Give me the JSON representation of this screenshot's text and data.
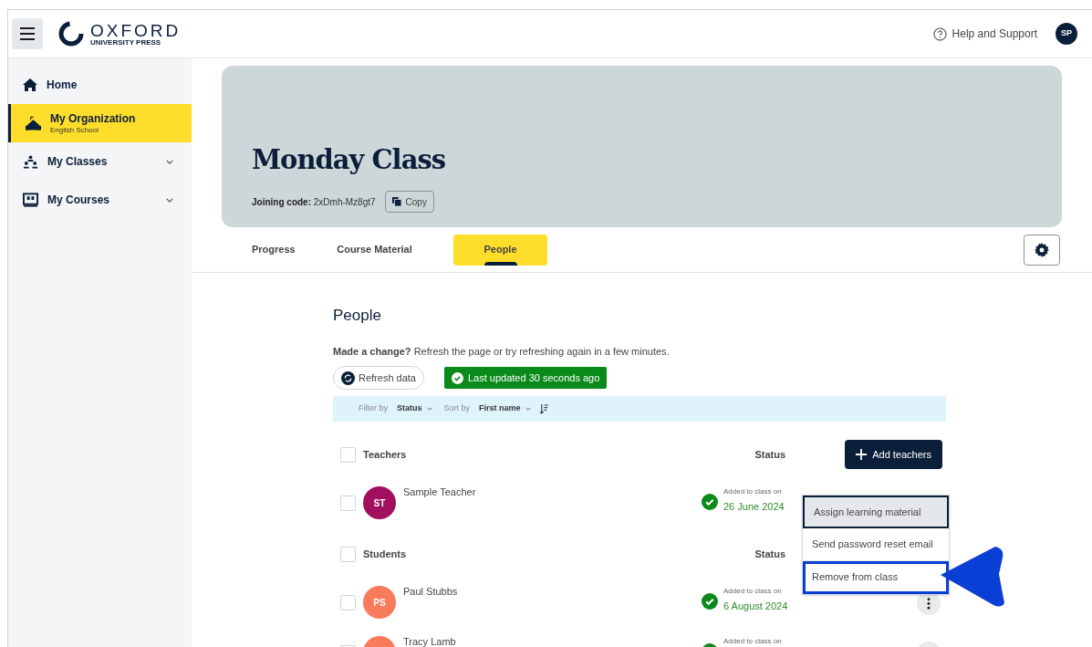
{
  "header": {
    "logo": {
      "name": "OXFORD",
      "sub": "UNIVERSITY PRESS"
    },
    "help": "Help and Support",
    "avatar": "SP"
  },
  "sidebar": {
    "items": [
      {
        "kind": "home",
        "label": "Home",
        "selected": false,
        "expandable": false
      },
      {
        "kind": "organization",
        "label": "My Organization",
        "sublabel": "English School",
        "selected": true,
        "expandable": false
      },
      {
        "kind": "classes",
        "label": "My Classes",
        "selected": false,
        "expandable": true
      },
      {
        "kind": "courses",
        "label": "My Courses",
        "selected": false,
        "expandable": true
      }
    ]
  },
  "banner": {
    "title": "Monday Class",
    "joining_label": "Joining code:",
    "code": "2xDmh-Mz8gt7",
    "copy": "Copy"
  },
  "tabs": [
    {
      "label": "Progress",
      "selected": false
    },
    {
      "label": "Course Material",
      "selected": false
    },
    {
      "label": "People",
      "selected": true
    }
  ],
  "people": {
    "heading": "People",
    "notice": "**Made a change?** Refresh the page or try refreshing again in a few minutes.",
    "refresh": "Refresh data",
    "updated": "Last updated 30 seconds ago",
    "toolbar": {
      "filter_label": "Filter by",
      "filter_value": "Status",
      "sort_label": "Sort by",
      "sort_value": "First name"
    },
    "groups": [
      {
        "title": "Teachers",
        "checked": false,
        "status_header": "Status",
        "action": "Add teachers",
        "members": [
          {
            "initials": "ST",
            "name": "Sample Teacher",
            "color": "#a0105f",
            "status_label": "Added to class on",
            "date": "26 June 2024",
            "menu_open": true,
            "checked": false
          }
        ]
      },
      {
        "title": "Students",
        "checked": false,
        "status_header": "Status",
        "members": [
          {
            "initials": "PS",
            "name": "Paul Stubbs",
            "color": "#fa7b5b",
            "status_label": "Added to class on",
            "date": "6 August 2024",
            "menu_open": false,
            "checked": false
          },
          {
            "name": "Tracy Lamb",
            "color": "#fa7b5b",
            "status_label": "Added to class on",
            "menu_open": false,
            "checked": false
          }
        ]
      }
    ],
    "menu": [
      {
        "label": "Assign learning material",
        "selected": true,
        "outlined": false
      },
      {
        "label": "Send password reset email",
        "selected": false,
        "outlined": false
      },
      {
        "label": "Remove from class",
        "selected": false,
        "outlined": true
      }
    ]
  }
}
